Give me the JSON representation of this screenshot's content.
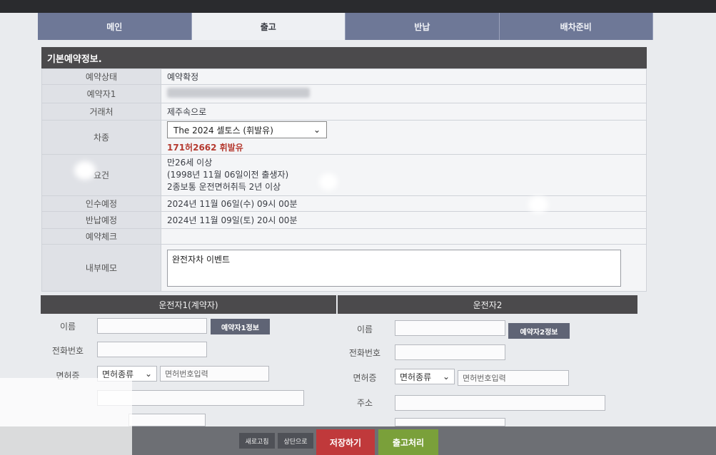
{
  "tabs": [
    "메인",
    "출고",
    "반납",
    "배차준비"
  ],
  "basic_section_title": "기본예약정보.",
  "fields": {
    "status_label": "예약상태",
    "status_value": "예약확정",
    "booker_label": "예약자1",
    "client_label": "거래처",
    "client_value": "제주속으로",
    "car_label": "차종",
    "car_value": "The 2024 셀토스 (휘발유)",
    "plate": "171허2662 휘발유",
    "req_label": "요건",
    "req_lines": [
      "만26세 이상",
      "(1998년 11월 06일이전 출생자)",
      "2종보통 운전면허취득 2년 이상"
    ],
    "pickup_label": "인수예정",
    "pickup_value": "2024년 11월 06일(수) 09시 00분",
    "return_label": "반납예정",
    "return_value": "2024년 11월 09일(토) 20시 00분",
    "check_label": "예약체크",
    "memo_label": "내부메모",
    "memo_value": "완전자차 이벤트"
  },
  "driver1": {
    "title": "운전자1(계약자)",
    "name_label": "이름",
    "info_button": "예약자1정보",
    "phone_label": "전화번호",
    "license_label": "면허증",
    "license_type": "면허종류",
    "license_placeholder": "면허번호입력"
  },
  "driver2": {
    "title": "운전자2",
    "name_label": "이름",
    "info_button": "예약자2정보",
    "phone_label": "전화번호",
    "license_label": "면허증",
    "license_type": "면허종류",
    "license_placeholder": "면허번호입력",
    "address_label": "주소"
  },
  "bottom_buttons": {
    "refresh": "새로고침",
    "to_top": "상단으로",
    "save": "저장하기",
    "checkout": "출고처리"
  },
  "colors": {
    "save": "#c0393b",
    "checkout": "#7aa03a",
    "header": "#4b4a4c",
    "tab": "#6e7897"
  }
}
